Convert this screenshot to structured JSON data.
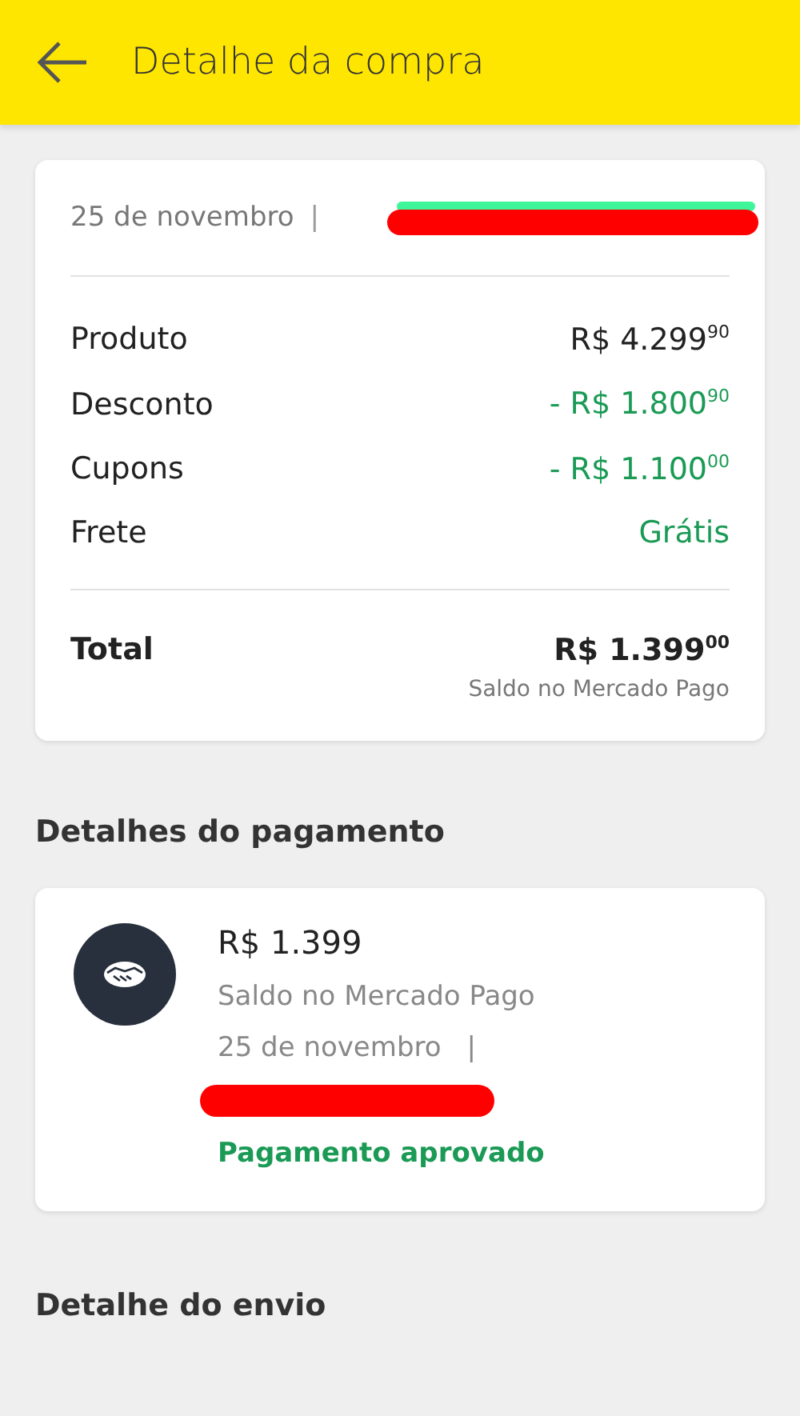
{
  "header": {
    "title": "Detalhe da compra"
  },
  "summary": {
    "date": "25 de novembro",
    "separator": "|",
    "order_redacted": true,
    "lines": [
      {
        "label": "Produto",
        "amount": "R$ 4.299$^{90}$",
        "kind": "plain"
      },
      {
        "label": "Desconto",
        "amount": "- R$ 1.800$^{90}$",
        "kind": "credit"
      },
      {
        "label": "Cupons",
        "amount": "- R$ 1.100$^{00}$",
        "kind": "credit"
      },
      {
        "label": "Frete",
        "amount": "Grátis",
        "kind": "credit"
      }
    ],
    "total": {
      "label": "Total",
      "amount": "R$ 1.399$^{00}$",
      "method": "Saldo no Mercado Pago"
    }
  },
  "payment": {
    "section_title": "Detalhes do pagamento",
    "amount": "R$ 1.399",
    "method": "Saldo no Mercado Pago",
    "date": "25 de novembro",
    "separator": "|",
    "operation_redacted": true,
    "status": "Pagamento aprovado"
  },
  "shipping": {
    "section_title": "Detalhe do envio"
  }
}
